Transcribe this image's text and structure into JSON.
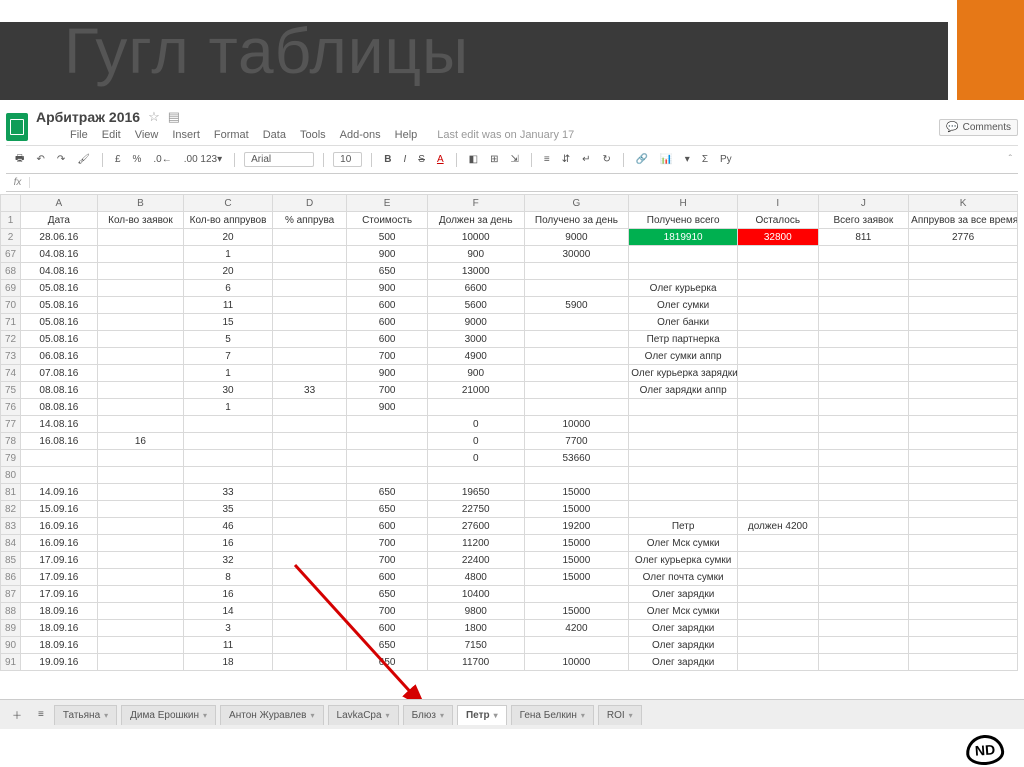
{
  "slide": {
    "title": "Гугл таблицы"
  },
  "doc": {
    "title": "Арбитраж 2016",
    "menus": [
      "File",
      "Edit",
      "View",
      "Insert",
      "Format",
      "Data",
      "Tools",
      "Add-ons",
      "Help"
    ],
    "last_edit": "Last edit was on January 17",
    "comments": "Comments"
  },
  "toolbar": {
    "print": "🖶",
    "undo": "↶",
    "redo": "↷",
    "paint": "🖌",
    "currency": "£",
    "percent": "%",
    "dec_dec": ".0←",
    "dec_inc": ".00  123▾",
    "font": "Arial",
    "size": "10",
    "bold": "B",
    "italic": "I",
    "strike": "S",
    "color": "A",
    "fill": "◧",
    "borders": "⊞",
    "merge": "⇲",
    "halign": "≡",
    "valign": "⇵",
    "wrap": "↵",
    "rotate": "↻",
    "link": "🔗",
    "chart": "📊",
    "filter": "▾",
    "funcs": "Σ",
    "lang": "Ру"
  },
  "columns": [
    "",
    "A",
    "B",
    "C",
    "D",
    "E",
    "F",
    "G",
    "H",
    "I",
    "J",
    "K"
  ],
  "header_row": [
    "1",
    "Дата",
    "Кол-во заявок",
    "Кол-во аппрувов",
    "% аппрува",
    "Стоимость",
    "Должен за день",
    "Получено за день",
    "Получено всего",
    "Осталось",
    "Всего заявок",
    "Аппрувов за все время"
  ],
  "rows": [
    {
      "n": "2",
      "A": "28.06.16",
      "B": "",
      "C": "20",
      "D": "",
      "E": "500",
      "F": "10000",
      "G": "9000",
      "H": "1819910",
      "I": "32800",
      "J": "811",
      "K": "2776",
      "hGreen": true,
      "iRed": true
    },
    {
      "n": "67",
      "A": "04.08.16",
      "B": "",
      "C": "1",
      "D": "",
      "E": "900",
      "F": "900",
      "G": "30000",
      "H": "",
      "I": "",
      "J": "",
      "K": ""
    },
    {
      "n": "68",
      "A": "04.08.16",
      "B": "",
      "C": "20",
      "D": "",
      "E": "650",
      "F": "13000",
      "G": "",
      "H": "",
      "I": "",
      "J": "",
      "K": ""
    },
    {
      "n": "69",
      "A": "05.08.16",
      "B": "",
      "C": "6",
      "D": "",
      "E": "900",
      "F": "6600",
      "G": "",
      "H": "Олег курьерка",
      "I": "",
      "J": "",
      "K": ""
    },
    {
      "n": "70",
      "A": "05.08.16",
      "B": "",
      "C": "11",
      "D": "",
      "E": "600",
      "F": "5600",
      "G": "5900",
      "H": "Олег сумки",
      "I": "",
      "J": "",
      "K": ""
    },
    {
      "n": "71",
      "A": "05.08.16",
      "B": "",
      "C": "15",
      "D": "",
      "E": "600",
      "F": "9000",
      "G": "",
      "H": "Олег банки",
      "I": "",
      "J": "",
      "K": ""
    },
    {
      "n": "72",
      "A": "05.08.16",
      "B": "",
      "C": "5",
      "D": "",
      "E": "600",
      "F": "3000",
      "G": "",
      "H": "Петр партнерка",
      "I": "",
      "J": "",
      "K": ""
    },
    {
      "n": "73",
      "A": "06.08.16",
      "B": "",
      "C": "7",
      "D": "",
      "E": "700",
      "F": "4900",
      "G": "",
      "H": "Олег сумки аппр",
      "I": "",
      "J": "",
      "K": ""
    },
    {
      "n": "74",
      "A": "07.08.16",
      "B": "",
      "C": "1",
      "D": "",
      "E": "900",
      "F": "900",
      "G": "",
      "H": "Олег курьерка зарядки",
      "I": "",
      "J": "",
      "K": ""
    },
    {
      "n": "75",
      "A": "08.08.16",
      "B": "",
      "C": "30",
      "D": "33",
      "E": "700",
      "F": "21000",
      "G": "",
      "H": "Олег зарядки аппр",
      "I": "",
      "J": "",
      "K": ""
    },
    {
      "n": "76",
      "A": "08.08.16",
      "B": "",
      "C": "1",
      "D": "",
      "E": "900",
      "F": "",
      "G": "",
      "H": "",
      "I": "",
      "J": "",
      "K": ""
    },
    {
      "n": "77",
      "A": "14.08.16",
      "B": "",
      "C": "",
      "D": "",
      "E": "",
      "F": "0",
      "G": "10000",
      "H": "",
      "I": "",
      "J": "",
      "K": ""
    },
    {
      "n": "78",
      "A": "16.08.16",
      "B": "16",
      "C": "",
      "D": "",
      "E": "",
      "F": "0",
      "G": "7700",
      "H": "",
      "I": "",
      "J": "",
      "K": ""
    },
    {
      "n": "79",
      "A": "",
      "B": "",
      "C": "",
      "D": "",
      "E": "",
      "F": "0",
      "G": "53660",
      "H": "",
      "I": "",
      "J": "",
      "K": ""
    },
    {
      "n": "80",
      "A": "",
      "B": "",
      "C": "",
      "D": "",
      "E": "",
      "F": "",
      "G": "",
      "H": "",
      "I": "",
      "J": "",
      "K": ""
    },
    {
      "n": "81",
      "A": "14.09.16",
      "B": "",
      "C": "33",
      "D": "",
      "E": "650",
      "F": "19650",
      "G": "15000",
      "H": "",
      "I": "",
      "J": "",
      "K": ""
    },
    {
      "n": "82",
      "A": "15.09.16",
      "B": "",
      "C": "35",
      "D": "",
      "E": "650",
      "F": "22750",
      "G": "15000",
      "H": "",
      "I": "",
      "J": "",
      "K": ""
    },
    {
      "n": "83",
      "A": "16.09.16",
      "B": "",
      "C": "46",
      "D": "",
      "E": "600",
      "F": "27600",
      "G": "19200",
      "H": "Петр",
      "I": "должен 4200",
      "J": "",
      "K": ""
    },
    {
      "n": "84",
      "A": "16.09.16",
      "B": "",
      "C": "16",
      "D": "",
      "E": "700",
      "F": "11200",
      "G": "15000",
      "H": "Олег Мск сумки",
      "I": "",
      "J": "",
      "K": ""
    },
    {
      "n": "85",
      "A": "17.09.16",
      "B": "",
      "C": "32",
      "D": "",
      "E": "700",
      "F": "22400",
      "G": "15000",
      "H": "Олег   курьерка сумки",
      "I": "",
      "J": "",
      "K": ""
    },
    {
      "n": "86",
      "A": "17.09.16",
      "B": "",
      "C": "8",
      "D": "",
      "E": "600",
      "F": "4800",
      "G": "15000",
      "H": "Олег почта сумки",
      "I": "",
      "J": "",
      "K": ""
    },
    {
      "n": "87",
      "A": "17.09.16",
      "B": "",
      "C": "16",
      "D": "",
      "E": "650",
      "F": "10400",
      "G": "",
      "H": "Олег зарядки",
      "I": "",
      "J": "",
      "K": ""
    },
    {
      "n": "88",
      "A": "18.09.16",
      "B": "",
      "C": "14",
      "D": "",
      "E": "700",
      "F": "9800",
      "G": "15000",
      "H": "Олег Мск сумки",
      "I": "",
      "J": "",
      "K": ""
    },
    {
      "n": "89",
      "A": "18.09.16",
      "B": "",
      "C": "3",
      "D": "",
      "E": "600",
      "F": "1800",
      "G": "4200",
      "H": "Олег зарядки",
      "I": "",
      "J": "",
      "K": ""
    },
    {
      "n": "90",
      "A": "18.09.16",
      "B": "",
      "C": "11",
      "D": "",
      "E": "650",
      "F": "7150",
      "G": "",
      "H": "Олег зарядки",
      "I": "",
      "J": "",
      "K": ""
    },
    {
      "n": "91",
      "A": "19.09.16",
      "B": "",
      "C": "18",
      "D": "",
      "E": "650",
      "F": "11700",
      "G": "10000",
      "H": "Олег зарядки",
      "I": "",
      "J": "",
      "K": ""
    }
  ],
  "tabs": [
    "Татьяна",
    "Дима Ерошкин",
    "Антон Журавлев",
    "LavkaCpa",
    "Блюз",
    "Петр",
    "Гена Белкин",
    "ROI"
  ],
  "active_tab": "Петр"
}
